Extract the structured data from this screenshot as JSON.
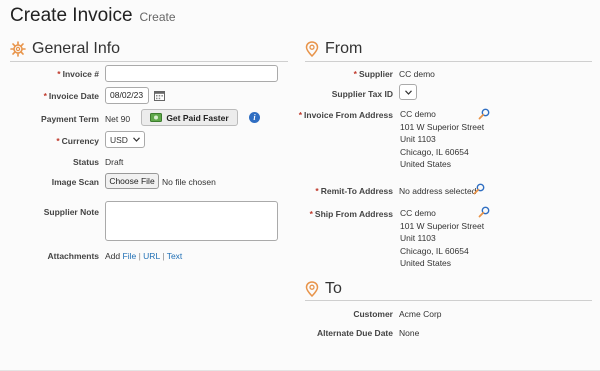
{
  "header": {
    "title": "Create Invoice",
    "subtitle": "Create"
  },
  "general": {
    "title": "General Info",
    "invoice_num": {
      "label": "Invoice #",
      "value": ""
    },
    "invoice_date": {
      "label": "Invoice Date",
      "value": "08/02/23"
    },
    "payment_term": {
      "label": "Payment Term",
      "value": "Net 90",
      "button": "Get Paid Faster"
    },
    "currency": {
      "label": "Currency",
      "value": "USD"
    },
    "status": {
      "label": "Status",
      "value": "Draft"
    },
    "image_scan": {
      "label": "Image Scan",
      "button": "Choose File",
      "text": "No file chosen"
    },
    "supplier_note": {
      "label": "Supplier Note",
      "value": ""
    },
    "attachments": {
      "label": "Attachments",
      "add": "Add",
      "file": "File",
      "sep1": "|",
      "url": "URL",
      "sep2": "|",
      "text": "Text"
    }
  },
  "from": {
    "title": "From",
    "supplier": {
      "label": "Supplier",
      "value": "CC demo"
    },
    "supplier_tax_id": {
      "label": "Supplier Tax ID",
      "value": ""
    },
    "invoice_from_address": {
      "label": "Invoice From Address",
      "lines": [
        "CC demo",
        "101 W Superior Street",
        "Unit 1103",
        "Chicago, IL 60654",
        "United States"
      ]
    },
    "remit_to_address": {
      "label": "Remit-To Address",
      "value": "No address selected"
    },
    "ship_from_address": {
      "label": "Ship From Address",
      "lines": [
        "CC demo",
        "101 W Superior Street",
        "Unit 1103",
        "Chicago, IL 60654",
        "United States"
      ]
    }
  },
  "to": {
    "title": "To",
    "customer": {
      "label": "Customer",
      "value": "Acme Corp"
    },
    "alternate_due_date": {
      "label": "Alternate Due Date",
      "value": "None"
    }
  },
  "colors": {
    "accent": "#e8944a",
    "required": "#c0392b",
    "link": "#1f6fb5",
    "info": "#2f6ec2"
  }
}
